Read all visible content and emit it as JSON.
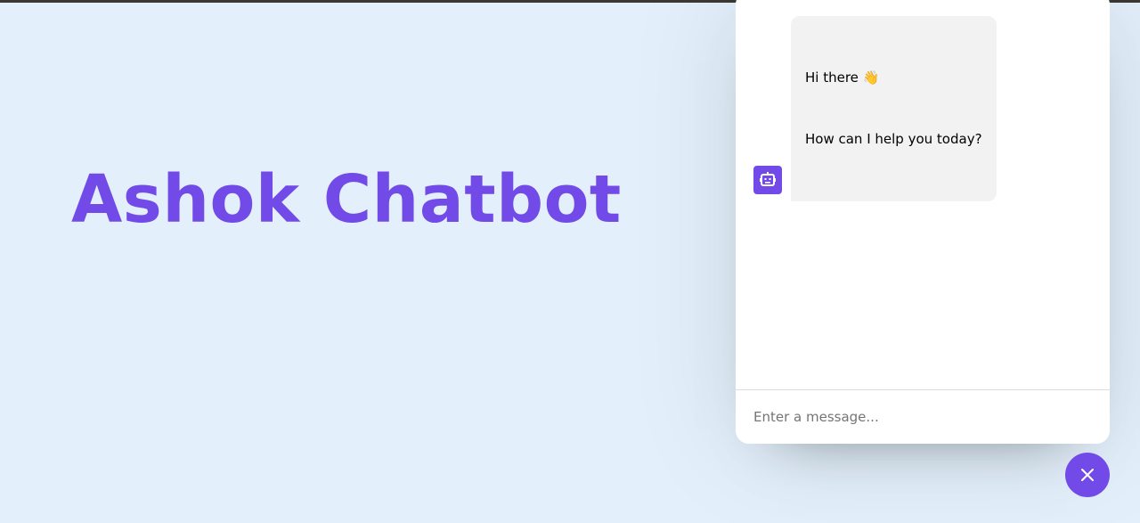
{
  "hero": {
    "title": "Ashok Chatbot"
  },
  "chat": {
    "messages": [
      {
        "sender": "bot",
        "lines": [
          "Hi there 👋",
          "How can I help you today?"
        ]
      }
    ],
    "input": {
      "placeholder": "Enter a message...",
      "value": ""
    }
  },
  "colors": {
    "accent": "#724ae8",
    "background": "#e3f0fb",
    "bubble": "#f2f2f2"
  },
  "icons": {
    "bot_avatar": "robot-icon",
    "toggler": "close-icon"
  }
}
